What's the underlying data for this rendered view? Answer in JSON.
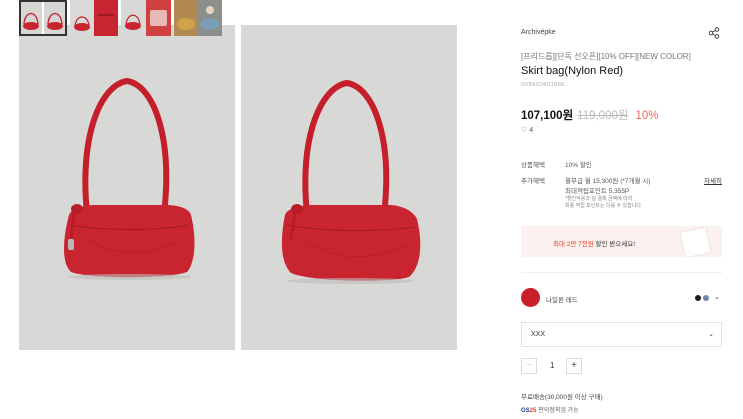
{
  "gallery": {
    "photos": [
      {
        "name": "product-photo-1",
        "icon": "red-handbag-image"
      },
      {
        "name": "product-photo-2",
        "icon": "red-handbag-image"
      }
    ],
    "thumbnail_count": 6
  },
  "product": {
    "brand": "Archivépke",
    "tags": "[프리드롭][단독 선오픈][10% OFF][NEW COLOR]",
    "name": "Skirt bag(Nylon Red)",
    "code": "OVBAX24011NRE",
    "sale_price": "107,100원",
    "original_price": "119,000원",
    "discount": "10%",
    "likes": "♡ 4"
  },
  "benefits": {
    "product_benefit_label": "상품혜택",
    "product_benefit_value": "10% 할인",
    "extra_benefit_label": "추가혜택",
    "installment": "월무급 월 15,300원 (*7개월 시)",
    "points": "최대적립포인트 5,355P",
    "detail_link": "자세히",
    "note_line1": "*할인적용과 실 결제 금액에 따라",
    "note_line2": "최종 적립 포인트는 다를 수 있습니다."
  },
  "banner": {
    "highlight": "최대 2만 7천원",
    "text": " 할인 받으세요!"
  },
  "options": {
    "color_name": "나일론 레드",
    "size_value": "XXX",
    "quantity": "1"
  },
  "shipping": {
    "free_shipping": "무료배송(30,000원 이상 구매)",
    "gs_logo": "GS25",
    "pickup": "편의점픽업 가능"
  },
  "colors": {
    "accent_red": "#c8202b",
    "discount": "#ee6a55",
    "banner_bg": "#fbf1ef",
    "swatch_black": "#1e1e1e",
    "swatch_blue": "#6f84a6"
  }
}
